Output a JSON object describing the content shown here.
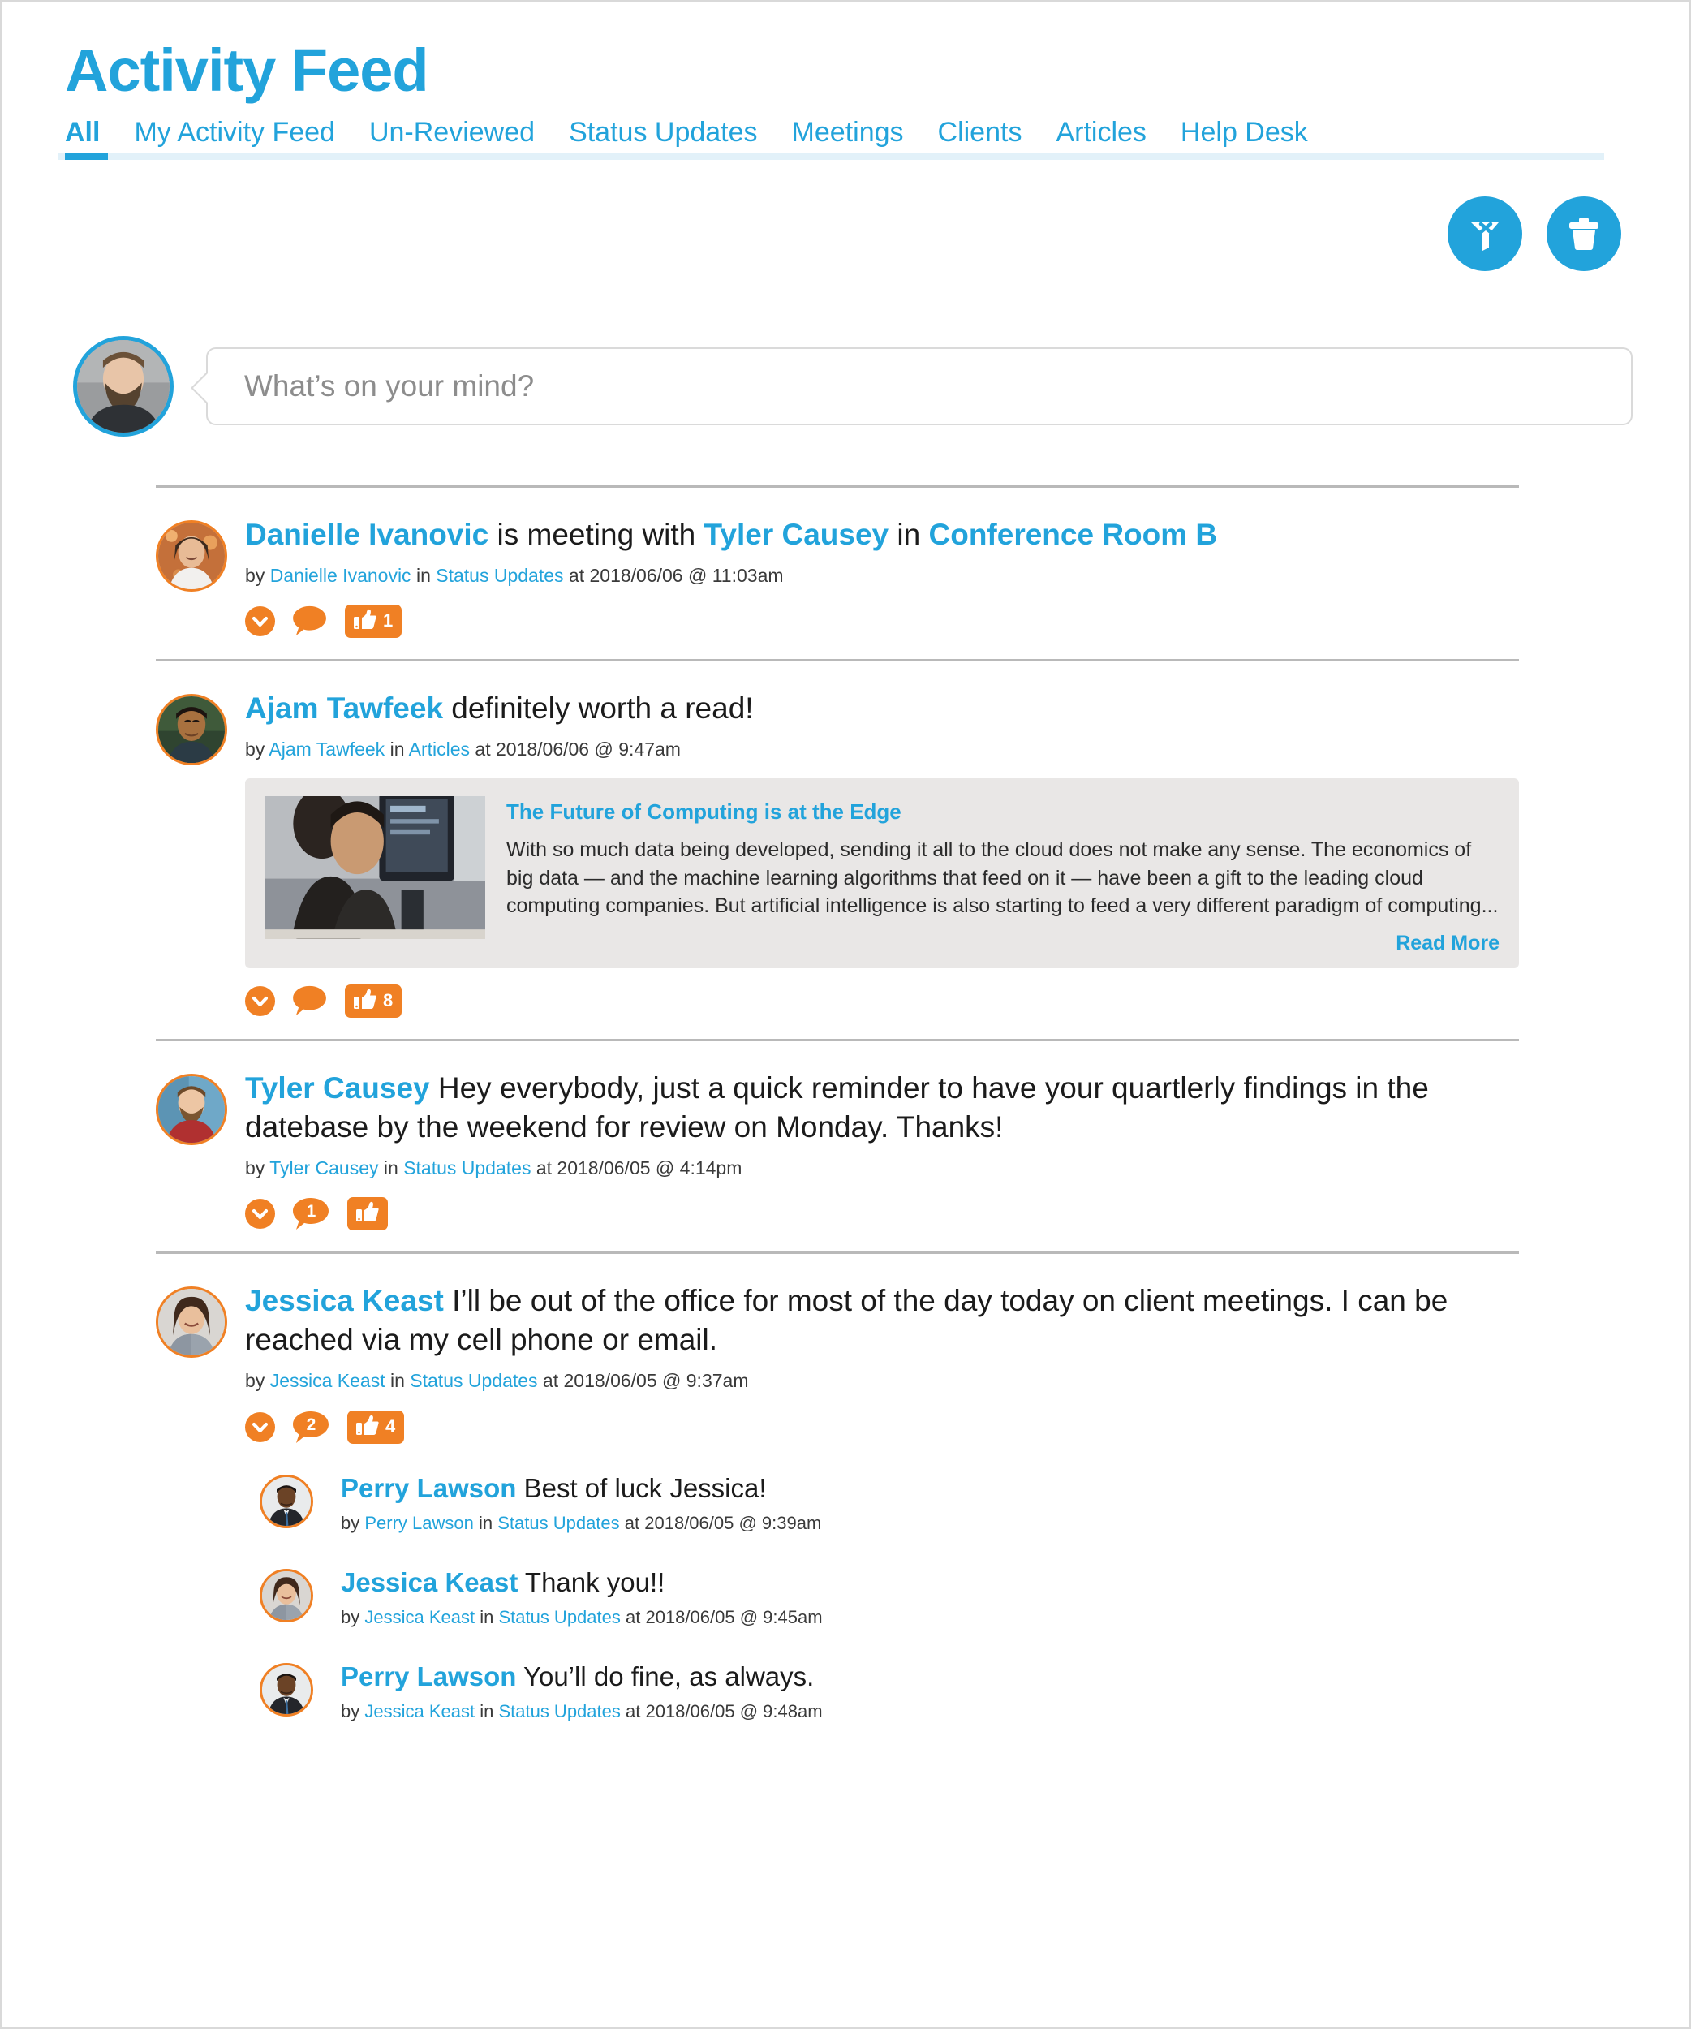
{
  "header": {
    "title": "Activity Feed",
    "tabs": [
      {
        "label": "All",
        "active": true
      },
      {
        "label": "My Activity Feed",
        "active": false
      },
      {
        "label": "Un-Reviewed",
        "active": false
      },
      {
        "label": "Status Updates",
        "active": false
      },
      {
        "label": "Meetings",
        "active": false
      },
      {
        "label": "Clients",
        "active": false
      },
      {
        "label": "Articles",
        "active": false
      },
      {
        "label": "Help Desk",
        "active": false
      }
    ]
  },
  "toolbar": {
    "clear_filter_icon": "filter-clear-icon",
    "delete_icon": "trash-icon"
  },
  "composer": {
    "placeholder": "What’s on your mind?",
    "avatar": "current-user-avatar"
  },
  "colors": {
    "accent_blue": "#22a3db",
    "action_orange": "#f08024",
    "card_gray": "#e9e7e6",
    "divider_gray": "#b9b9b9"
  },
  "posts": [
    {
      "avatar": "danielle-ivanovic-avatar",
      "text_parts": [
        {
          "t": "Danielle Ivanovic",
          "style": "author"
        },
        {
          "t": " is meeting with ",
          "style": "plain"
        },
        {
          "t": "Tyler Causey",
          "style": "author"
        },
        {
          "t": " in ",
          "style": "plain"
        },
        {
          "t": "Conference Room B",
          "style": "author"
        }
      ],
      "meta": {
        "by_label": "by",
        "author": "Danielle Ivanovic",
        "in_label": "in",
        "category": "Status Updates",
        "at_label": "at",
        "timestamp": "2018/06/06 @ 11:03am"
      },
      "actions": {
        "expand": true,
        "comment_count": "",
        "like_count": "1"
      },
      "article": null,
      "comments": []
    },
    {
      "avatar": "ajam-tawfeek-avatar",
      "text_parts": [
        {
          "t": "Ajam Tawfeek",
          "style": "author"
        },
        {
          "t": " definitely worth a read!",
          "style": "plain"
        }
      ],
      "meta": {
        "by_label": "by",
        "author": "Ajam Tawfeek",
        "in_label": "in",
        "category": "Articles",
        "at_label": "at",
        "timestamp": "2018/06/06 @ 9:47am"
      },
      "actions": {
        "expand": true,
        "comment_count": "",
        "like_count": "8"
      },
      "article": {
        "title": "The Future of Computing is at the Edge",
        "excerpt": "With so much data being developed, sending it all to the cloud does not make any sense. The economics of big data — and the machine learning algorithms that feed on it — have been a gift to the leading cloud computing companies. But artificial intelligence is also starting to feed a very different paradigm of computing...",
        "read_more": "Read More",
        "thumbnail": "office-workers-at-computers-photo"
      },
      "comments": []
    },
    {
      "avatar": "tyler-causey-avatar",
      "text_parts": [
        {
          "t": "Tyler Causey",
          "style": "author"
        },
        {
          "t": " Hey everybody, just a quick reminder to have your quartlerly findings in the datebase by the weekend for review on Monday. Thanks!",
          "style": "plain"
        }
      ],
      "meta": {
        "by_label": "by",
        "author": "Tyler Causey",
        "in_label": "in",
        "category": "Status Updates",
        "at_label": "at",
        "timestamp": "2018/06/05 @ 4:14pm"
      },
      "actions": {
        "expand": true,
        "comment_count": "1",
        "like_count": ""
      },
      "article": null,
      "comments": []
    },
    {
      "avatar": "jessica-keast-avatar",
      "text_parts": [
        {
          "t": "Jessica Keast",
          "style": "author"
        },
        {
          "t": " I’ll be out of the office for most of the day today on client meetings. I can be reached via my cell phone or email.",
          "style": "plain"
        }
      ],
      "meta": {
        "by_label": "by",
        "author": "Jessica Keast",
        "in_label": "in",
        "category": "Status Updates",
        "at_label": "at",
        "timestamp": "2018/06/05 @ 9:37am"
      },
      "actions": {
        "expand": true,
        "comment_count": "2",
        "like_count": "4"
      },
      "article": null,
      "comments": [
        {
          "avatar": "perry-lawson-avatar",
          "author": "Perry Lawson",
          "text": " Best of luck Jessica!",
          "meta": {
            "by_label": "by",
            "author": "Perry Lawson",
            "in_label": "in",
            "category": "Status Updates",
            "at_label": "at",
            "timestamp": "2018/06/05 @ 9:39am"
          }
        },
        {
          "avatar": "jessica-keast-avatar",
          "author": "Jessica Keast",
          "text": " Thank you!!",
          "meta": {
            "by_label": "by",
            "author": "Jessica Keast",
            "in_label": "in",
            "category": "Status Updates",
            "at_label": "at",
            "timestamp": "2018/06/05 @ 9:45am"
          }
        },
        {
          "avatar": "perry-lawson-avatar",
          "author": "Perry Lawson",
          "text": " You’ll do fine, as always.",
          "meta": {
            "by_label": "by",
            "author": "Jessica Keast",
            "in_label": "in",
            "category": "Status Updates",
            "at_label": "at",
            "timestamp": "2018/06/05 @ 9:48am"
          }
        }
      ]
    }
  ]
}
